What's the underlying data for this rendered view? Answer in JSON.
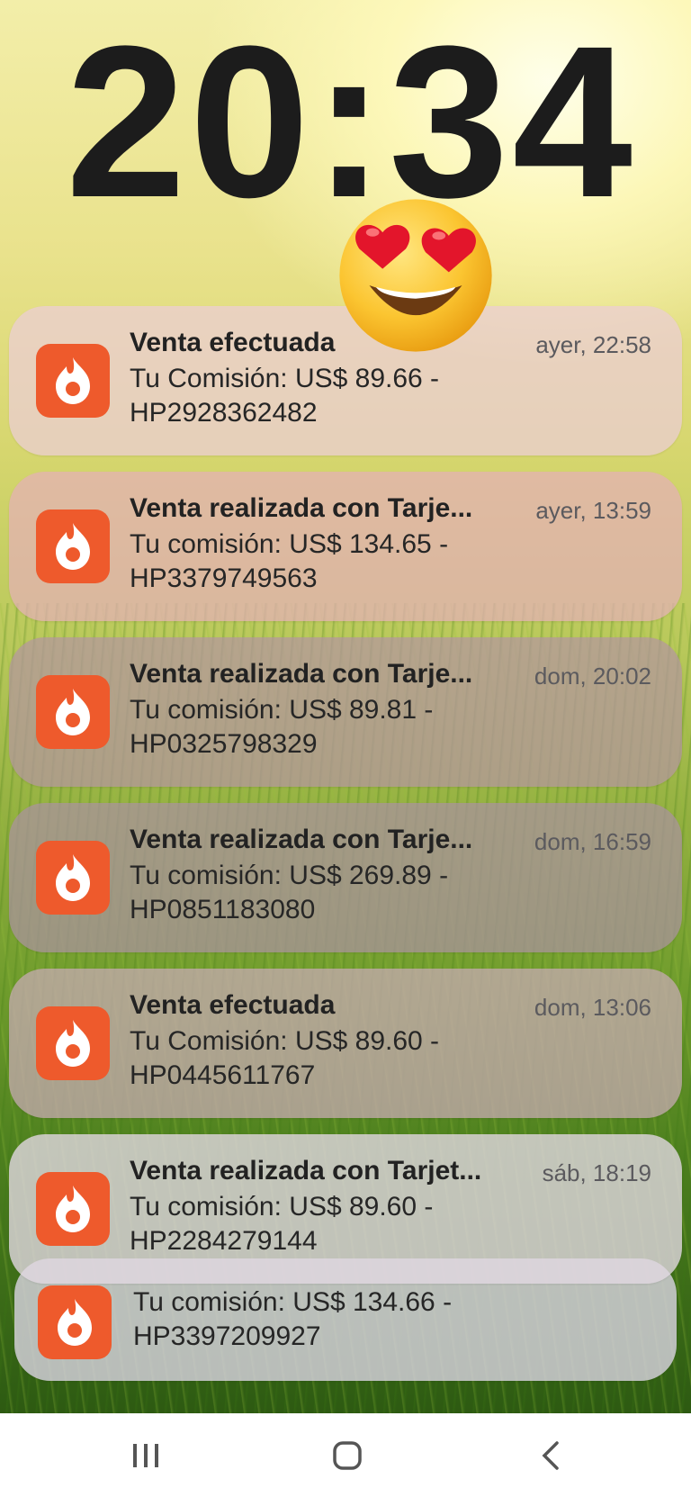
{
  "lockscreen": {
    "clock": "20:34"
  },
  "notifications": [
    {
      "title": "Venta efectuada",
      "time": "ayer, 22:58",
      "line1": "Tu Comisión: US$ 89.66 -",
      "line2": "HP2928362482",
      "icon": "hotmart-flame-icon"
    },
    {
      "title": "Venta realizada con Tarje...",
      "time": "ayer, 13:59",
      "line1": "Tu comisión: US$ 134.65 -",
      "line2": "HP3379749563",
      "icon": "hotmart-flame-icon"
    },
    {
      "title": "Venta realizada con Tarje...",
      "time": "dom, 20:02",
      "line1": "Tu comisión: US$ 89.81 -",
      "line2": "HP0325798329",
      "icon": "hotmart-flame-icon"
    },
    {
      "title": "Venta realizada con Tarje...",
      "time": "dom, 16:59",
      "line1": "Tu comisión: US$ 269.89 -",
      "line2": "HP0851183080",
      "icon": "hotmart-flame-icon"
    },
    {
      "title": "Venta efectuada",
      "time": "dom, 13:06",
      "line1": "Tu Comisión: US$ 89.60 -",
      "line2": "HP0445611767",
      "icon": "hotmart-flame-icon"
    },
    {
      "title": "Venta realizada con Tarjet...",
      "time": "sáb, 18:19",
      "line1": "Tu comisión: US$ 89.60 -",
      "line2": "HP2284279144",
      "icon": "hotmart-flame-icon"
    }
  ],
  "stacked_notification": {
    "line1": "Tu comisión: US$ 134.66 -",
    "line2": "HP3397209927",
    "icon": "hotmart-flame-icon"
  },
  "colors": {
    "app_icon": "#ee5a2c",
    "clock": "#1c1c1c"
  },
  "navbar": {
    "icons": [
      "recents-icon",
      "home-icon",
      "back-icon"
    ]
  }
}
